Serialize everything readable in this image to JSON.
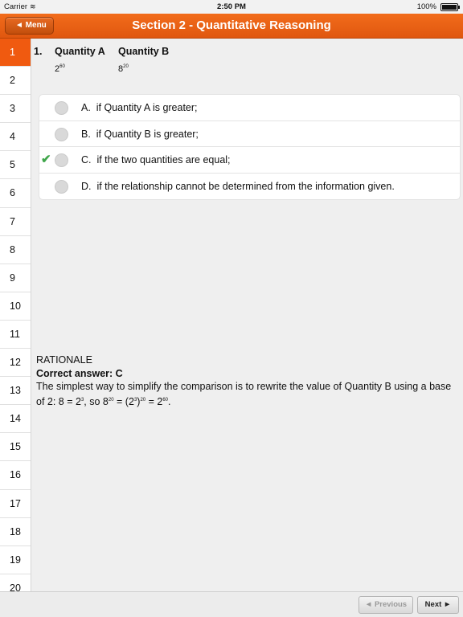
{
  "status_bar": {
    "carrier": "Carrier",
    "time": "2:50 PM",
    "battery": "100%"
  },
  "nav": {
    "title": "Section 2 - Quantitative Reasoning",
    "menu_label": "◄ Menu"
  },
  "sidebar": {
    "items": [
      "1",
      "2",
      "3",
      "4",
      "5",
      "6",
      "7",
      "8",
      "9",
      "10",
      "11",
      "12",
      "13",
      "14",
      "15",
      "16",
      "17",
      "18",
      "19",
      "20"
    ],
    "active": "1"
  },
  "question": {
    "number": "1.",
    "quantity_a_label": "Quantity A",
    "quantity_b_label": "Quantity B",
    "quantity_a_base": "2",
    "quantity_a_exp": "60",
    "quantity_b_base": "8",
    "quantity_b_exp": "20"
  },
  "options": [
    {
      "letter": "A.",
      "text": "if Quantity A is greater;",
      "checked": false
    },
    {
      "letter": "B.",
      "text": "if Quantity B is greater;",
      "checked": false
    },
    {
      "letter": "C.",
      "text": "if the two quantities are equal;",
      "checked": true
    },
    {
      "letter": "D.",
      "text": "if the relationship cannot be determined from the information given.",
      "checked": false
    }
  ],
  "rationale": {
    "heading": "RATIONALE",
    "correct": "Correct answer: C",
    "p1": "The simplest way to simplify the comparison is to rewrite the value of Quantity B using a base of 2: 8 = 2",
    "e1": "3",
    "p2": ", so 8",
    "e2": "20",
    "p3": " = (2",
    "e3": "3",
    "p4": ")",
    "e4": "20",
    "p5": " = 2",
    "e5": "60",
    "p6": "."
  },
  "footer": {
    "previous_label": "◄ Previous",
    "next_label": "Next ►"
  },
  "colors": {
    "accent": "#f05a10",
    "check": "#3fa64a"
  }
}
